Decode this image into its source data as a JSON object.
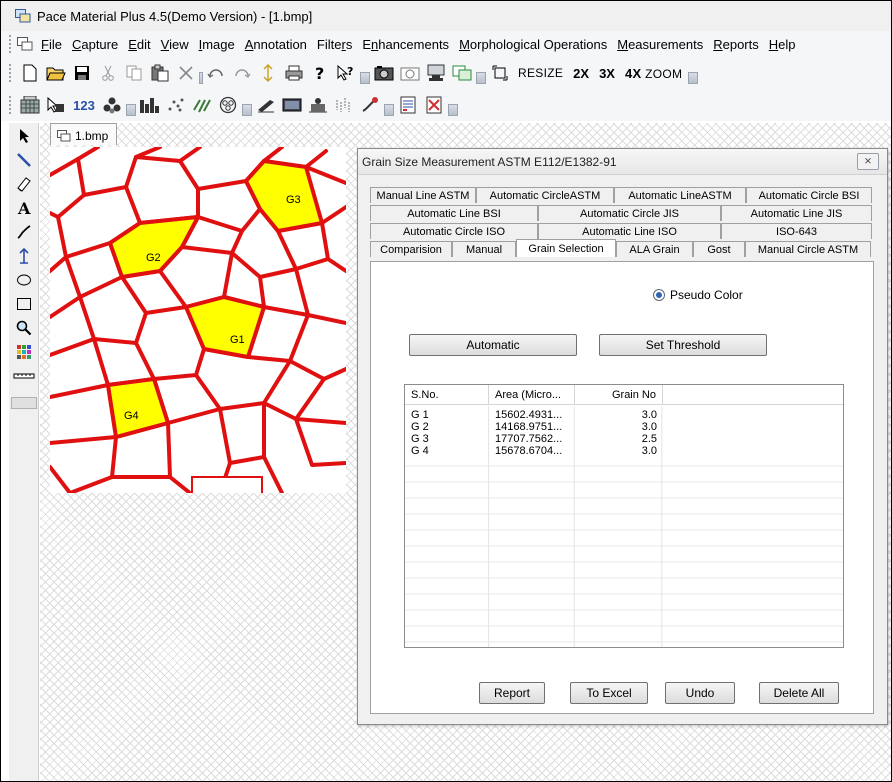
{
  "window": {
    "title": "Pace Material Plus 4.5(Demo Version) - [1.bmp]"
  },
  "menu": [
    {
      "pre": "",
      "u": "F",
      "post": "ile"
    },
    {
      "pre": "",
      "u": "C",
      "post": "apture"
    },
    {
      "pre": "",
      "u": "E",
      "post": "dit"
    },
    {
      "pre": "",
      "u": "V",
      "post": "iew"
    },
    {
      "pre": "",
      "u": "I",
      "post": "mage"
    },
    {
      "pre": "",
      "u": "A",
      "post": "nnotation"
    },
    {
      "pre": "Filte",
      "u": "r",
      "post": "s"
    },
    {
      "pre": "E",
      "u": "n",
      "post": "hancements"
    },
    {
      "pre": "",
      "u": "M",
      "post": "orphological Operations"
    },
    {
      "pre": "",
      "u": "M",
      "post": "easurements"
    },
    {
      "pre": "",
      "u": "R",
      "post": "eports"
    },
    {
      "pre": "",
      "u": "H",
      "post": "elp"
    }
  ],
  "toolbar": {
    "resize": "RESIZE",
    "zoom2": "2X",
    "zoom3": "3X",
    "zoom4": "4X",
    "zoom": "ZOOM",
    "count": "123"
  },
  "document": {
    "tab_label": "1.bmp"
  },
  "grains": {
    "g1": "G1",
    "g2": "G2",
    "g3": "G3",
    "g4": "G4"
  },
  "dialog": {
    "title": "Grain Size Measurement ASTM E112/E1382-91",
    "close": "⨯",
    "tab_rows": [
      [
        "Manual Line ASTM",
        "Automatic CircleASTM",
        "Automatic LineASTM",
        "Automatic Circle BSI"
      ],
      [
        "Automatic Line BSI",
        "Automatic Circle JIS",
        "Automatic Line JIS"
      ],
      [
        "Automatic Circle ISO",
        "Automatic Line ISO",
        "ISO-643"
      ],
      [
        "Comparision",
        "Manual",
        "Grain Selection",
        "ALA Grain",
        "Gost",
        "Manual Circle ASTM"
      ]
    ],
    "active_tab": "Grain Selection",
    "pseudo_color": "Pseudo Color",
    "automatic": "Automatic",
    "set_threshold": "Set Threshold",
    "columns": [
      "S.No.",
      "Area (Micro...",
      "Grain No"
    ],
    "rows": [
      [
        "G 1",
        "15602.4931...",
        "3.0"
      ],
      [
        "G 2",
        "14168.9751...",
        "3.0"
      ],
      [
        "G 3",
        "17707.7562...",
        "2.5"
      ],
      [
        "G 4",
        "15678.6704...",
        "3.0"
      ]
    ],
    "buttons": {
      "report": "Report",
      "excel": "To Excel",
      "undo": "Undo",
      "delete_all": "Delete All"
    }
  },
  "colors": {
    "grain_boundary": "#e01010",
    "selected_grain": "#ffff00",
    "accent": "#2d66b8"
  }
}
